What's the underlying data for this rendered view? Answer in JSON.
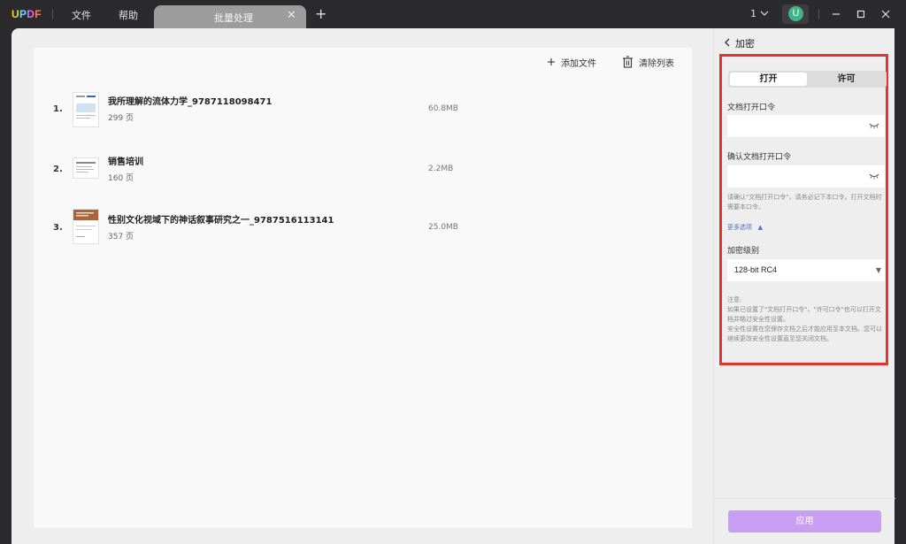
{
  "app": {
    "logo": [
      "U",
      "P",
      "D",
      "F"
    ],
    "menu": [
      "文件",
      "帮助"
    ],
    "tab_label": "批量处理",
    "tab_close": "✕",
    "tab_add": "+",
    "page_count": "1",
    "avatar_letter": "U",
    "colors": {
      "accent": "#c89ef3",
      "highlight": "#e4332e",
      "avatar": "#3fb48a"
    }
  },
  "toolbar": {
    "add_file": "添加文件",
    "clear_list": "清除列表"
  },
  "files": [
    {
      "index": "1.",
      "name": "我所理解的流体力学_9787118098471",
      "pages": "299 页",
      "size": "60.8MB"
    },
    {
      "index": "2.",
      "name": "销售培训",
      "pages": "160 页",
      "size": "2.2MB"
    },
    {
      "index": "3.",
      "name": "性别文化视域下的神话叙事研究之一_9787516113141",
      "pages": "357 页",
      "size": "25.0MB"
    }
  ],
  "sidebar": {
    "title": "加密",
    "tabs": [
      "打开",
      "许可"
    ],
    "open_password_label": "文档打开口令",
    "confirm_password_label": "确认文档打开口令",
    "hint": "请确认\"文档打开口令\"，请务必记下本口令。打开文档时需要本口令。",
    "more_options": "更多选项",
    "encryption_level_label": "加密级别",
    "encryption_level_value": "128-bit RC4",
    "note_title": "注意:",
    "note_1": "如果已设置了\"文档打开口令\"、\"许可口令\"也可以打开文档并略过安全性设置。",
    "note_2": "安全性设置在您保存文档之后才能应用至本文档。您可以继续更改安全性设置直至您关闭文档。",
    "apply": "应用"
  }
}
